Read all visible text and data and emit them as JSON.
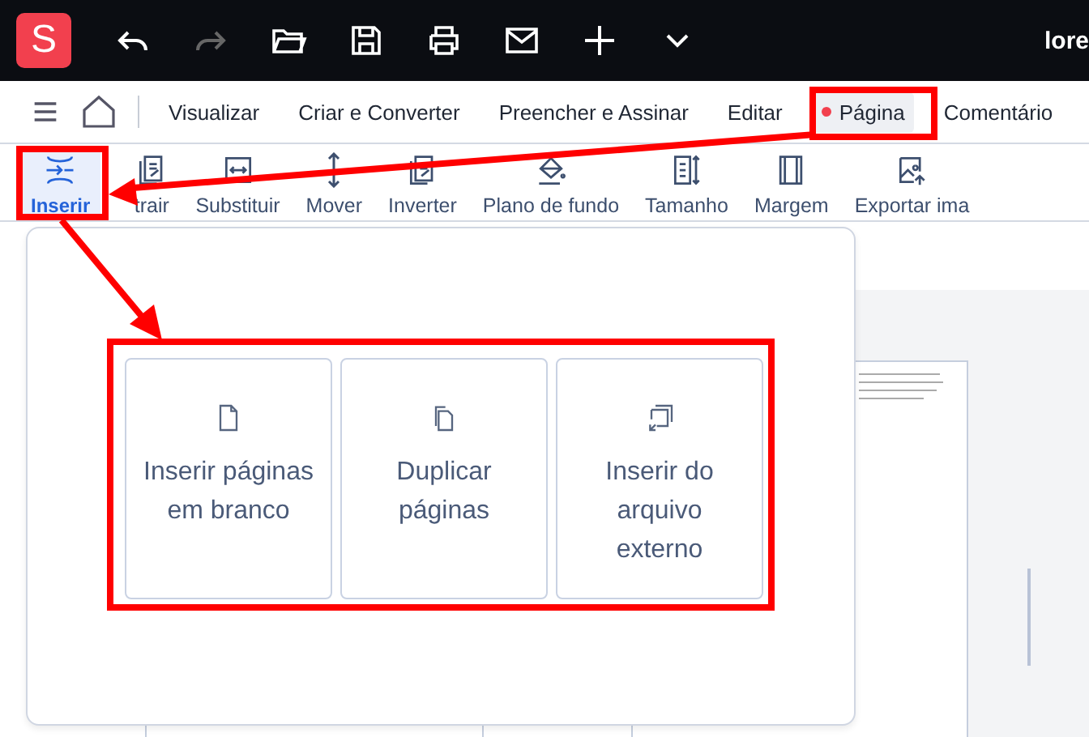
{
  "app": {
    "logo": "S",
    "user": "lore"
  },
  "menu": [
    {
      "label": "Visualizar",
      "selected": false,
      "dot": false
    },
    {
      "label": "Criar e Converter",
      "selected": false,
      "dot": false
    },
    {
      "label": "Preencher e Assinar",
      "selected": false,
      "dot": false
    },
    {
      "label": "Editar",
      "selected": false,
      "dot": false
    },
    {
      "label": "Página",
      "selected": true,
      "dot": true
    },
    {
      "label": "Comentário",
      "selected": false,
      "dot": false
    }
  ],
  "toolbar": [
    {
      "label": "Inserir",
      "selected": true
    },
    {
      "label": "trair",
      "selected": false
    },
    {
      "label": "Substituir",
      "selected": false
    },
    {
      "label": "Mover",
      "selected": false
    },
    {
      "label": "Inverter",
      "selected": false
    },
    {
      "label": "Plano de fundo",
      "selected": false
    },
    {
      "label": "Tamanho",
      "selected": false
    },
    {
      "label": "Margem",
      "selected": false
    },
    {
      "label": "Exportar ima",
      "selected": false
    }
  ],
  "insert_panel": {
    "options": [
      {
        "label": "Inserir páginas em branco"
      },
      {
        "label": "Duplicar páginas"
      },
      {
        "label": "Inserir do arquivo externo"
      }
    ]
  }
}
